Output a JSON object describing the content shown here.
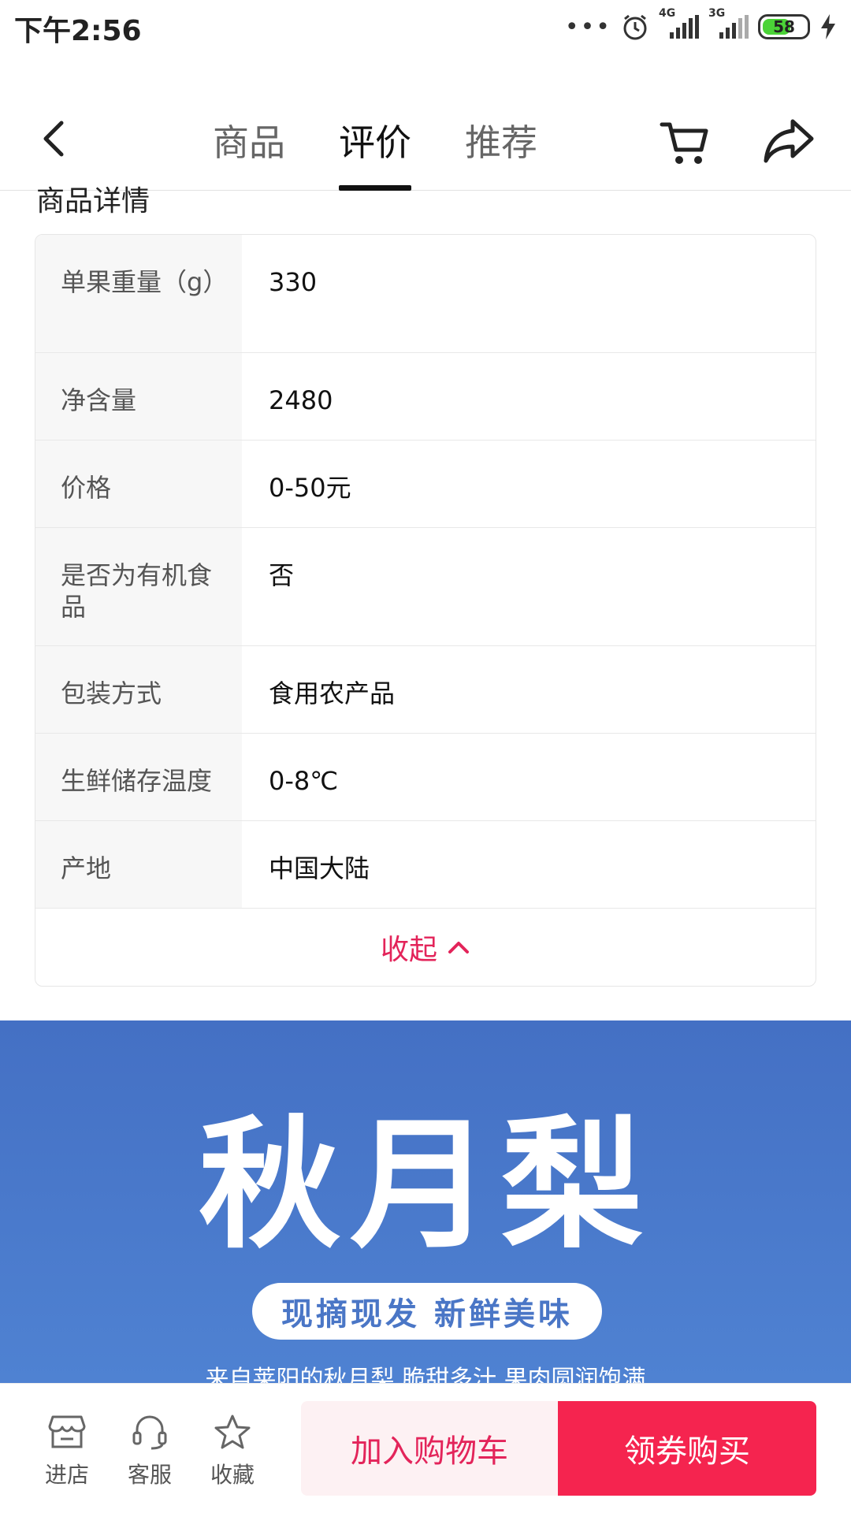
{
  "status_bar": {
    "time": "下午2:56",
    "dots": "•••",
    "network_1": "4G",
    "network_2": "3G",
    "battery": "58"
  },
  "nav": {
    "tabs": [
      {
        "label": "商品"
      },
      {
        "label": "评价"
      },
      {
        "label": "推荐"
      }
    ],
    "active_tab": "评价"
  },
  "section": {
    "title": "商品详情"
  },
  "specs": {
    "rows": [
      {
        "key": "单果重量（g）",
        "value": "330"
      },
      {
        "key": "净含量",
        "value": "2480"
      },
      {
        "key": "价格",
        "value": "0-50元"
      },
      {
        "key": "是否为有机食品",
        "value": "否"
      },
      {
        "key": "包装方式",
        "value": "食用农产品"
      },
      {
        "key": "生鲜储存温度",
        "value": "0-8℃"
      },
      {
        "key": "产地",
        "value": "中国大陆"
      }
    ],
    "collapse_label": "收起"
  },
  "banner": {
    "title": "秋月梨",
    "pill_text": "现摘现发 新鲜美味",
    "subtitle": "来自莱阳的秋月梨 脆甜多汁 果肉圆润饱满"
  },
  "bottom_bar": {
    "store_label": "进店",
    "service_label": "客服",
    "favorite_label": "收藏",
    "add_cart_label": "加入购物车",
    "buy_label": "领券购买"
  },
  "colors": {
    "accent": "#e3245a",
    "buy_button": "#f5244f",
    "banner_bg": "#4470c4",
    "battery": "#4bd337"
  }
}
